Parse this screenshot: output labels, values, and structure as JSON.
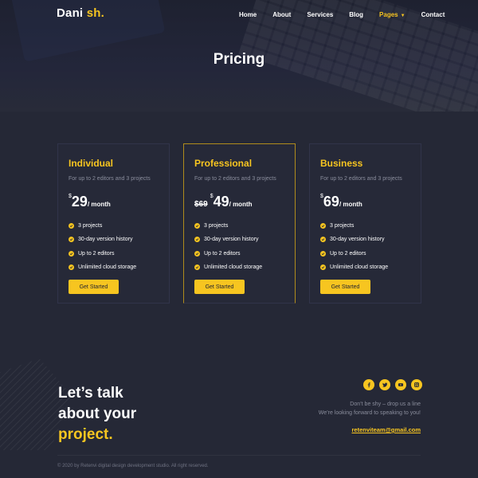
{
  "brand": {
    "name_primary": "Dani",
    "name_accent": "sh."
  },
  "nav": {
    "items": [
      {
        "label": "Home"
      },
      {
        "label": "About"
      },
      {
        "label": "Services"
      },
      {
        "label": "Blog"
      },
      {
        "label": "Pages"
      },
      {
        "label": "Contact"
      }
    ],
    "active": "Pages"
  },
  "hero": {
    "title": "Pricing"
  },
  "plans": [
    {
      "name": "Individual",
      "subtitle": "For up to 2 editors and 3 projects",
      "old_price": "",
      "currency": "$",
      "price": "29",
      "period": "/ month",
      "features": [
        "3 projects",
        "30-day version history",
        "Up to 2 editors",
        "Unlimited cloud storage"
      ],
      "cta": "Get Started"
    },
    {
      "name": "Professional",
      "subtitle": "For up to 2 editors and 3 projects",
      "old_price": "$69",
      "currency": "$",
      "price": "49",
      "period": "/ month",
      "features": [
        "3 projects",
        "30-day version history",
        "Up to 2 editors",
        "Unlimited cloud storage"
      ],
      "cta": "Get Started"
    },
    {
      "name": "Business",
      "subtitle": "For up to 2 editors and 3 projects",
      "old_price": "",
      "currency": "$",
      "price": "69",
      "period": "/ month",
      "features": [
        "3 projects",
        "30-day version history",
        "Up to 2 editors",
        "Unlimited cloud storage"
      ],
      "cta": "Get Started"
    }
  ],
  "contact": {
    "heading_line1": "Let’s talk",
    "heading_line2": "about your",
    "heading_accent": "project.",
    "line1": "Don’t be shy – drop us a line",
    "line2": "We’re looking forward to speaking to you!",
    "email": "retenviteam@gmail.com",
    "socials": [
      "facebook-icon",
      "twitter-icon",
      "youtube-icon",
      "instagram-icon"
    ]
  },
  "footer": {
    "copyright": "© 2020 by Retenvi digital design development studio. All right reserved."
  },
  "colors": {
    "accent": "#f7c520",
    "background": "#252836",
    "card_border": "#31344a",
    "muted_text": "#8a8d9c"
  }
}
